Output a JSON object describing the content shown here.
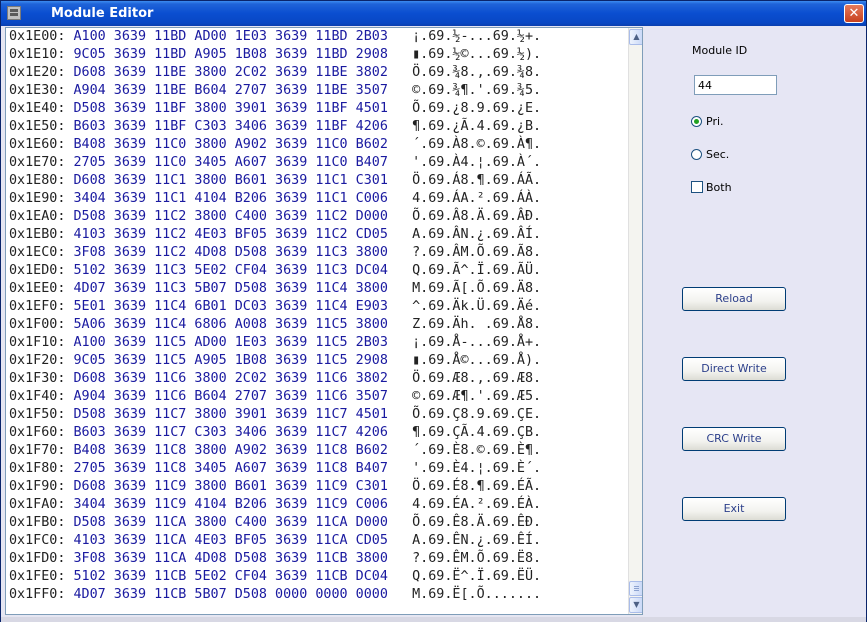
{
  "window": {
    "title": "Module Editor",
    "close_glyph": "✕"
  },
  "icons": {
    "app": "app-window-icon",
    "close": "close-icon",
    "scroll_up": "arrow-up-icon",
    "scroll_down": "arrow-down-icon"
  },
  "colors": {
    "title_bar": "#0a4ed0",
    "hex_values": "#1a1aa0",
    "radio_dot": "#21a121",
    "button_text": "#2b3e8a",
    "side_panel": "#e6e6f4"
  },
  "hex_rows": [
    {
      "addr": "0x1E00:",
      "hex": "A100 3639 11BD AD00 1E03 3639 11BD 2B03",
      "ascii": "¡.69.½-...69.½+."
    },
    {
      "addr": "0x1E10:",
      "hex": "9C05 3639 11BD A905 1B08 3639 11BD 2908",
      "ascii": "▮.69.½©...69.½)."
    },
    {
      "addr": "0x1E20:",
      "hex": "D608 3639 11BE 3800 2C02 3639 11BE 3802",
      "ascii": "Ö.69.¾8.,.69.¾8."
    },
    {
      "addr": "0x1E30:",
      "hex": "A904 3639 11BE B604 2707 3639 11BE 3507",
      "ascii": "©.69.¾¶.'.69.¾5."
    },
    {
      "addr": "0x1E40:",
      "hex": "D508 3639 11BF 3800 3901 3639 11BF 4501",
      "ascii": "Õ.69.¿8.9.69.¿E."
    },
    {
      "addr": "0x1E50:",
      "hex": "B603 3639 11BF C303 3406 3639 11BF 4206",
      "ascii": "¶.69.¿Ã.4.69.¿B."
    },
    {
      "addr": "0x1E60:",
      "hex": "B408 3639 11C0 3800 A902 3639 11C0 B602",
      "ascii": "´.69.À8.©.69.À¶."
    },
    {
      "addr": "0x1E70:",
      "hex": "2705 3639 11C0 3405 A607 3639 11C0 B407",
      "ascii": "'.69.À4.¦.69.À´."
    },
    {
      "addr": "0x1E80:",
      "hex": "D608 3639 11C1 3800 B601 3639 11C1 C301",
      "ascii": "Ö.69.Á8.¶.69.ÁÃ."
    },
    {
      "addr": "0x1E90:",
      "hex": "3404 3639 11C1 4104 B206 3639 11C1 C006",
      "ascii": "4.69.ÁA.².69.ÁÀ."
    },
    {
      "addr": "0x1EA0:",
      "hex": "D508 3639 11C2 3800 C400 3639 11C2 D000",
      "ascii": "Õ.69.Â8.Ä.69.ÂÐ."
    },
    {
      "addr": "0x1EB0:",
      "hex": "4103 3639 11C2 4E03 BF05 3639 11C2 CD05",
      "ascii": "A.69.ÂN.¿.69.ÂÍ."
    },
    {
      "addr": "0x1EC0:",
      "hex": "3F08 3639 11C2 4D08 D508 3639 11C3 3800",
      "ascii": "?.69.ÂM.Õ.69.Ã8."
    },
    {
      "addr": "0x1ED0:",
      "hex": "5102 3639 11C3 5E02 CF04 3639 11C3 DC04",
      "ascii": "Q.69.Ã^.Ï.69.ÃÜ."
    },
    {
      "addr": "0x1EE0:",
      "hex": "4D07 3639 11C3 5B07 D508 3639 11C4 3800",
      "ascii": "M.69.Ã[.Õ.69.Ä8."
    },
    {
      "addr": "0x1EF0:",
      "hex": "5E01 3639 11C4 6B01 DC03 3639 11C4 E903",
      "ascii": "^.69.Äk.Ü.69.Äé."
    },
    {
      "addr": "0x1F00:",
      "hex": "5A06 3639 11C4 6806 A008 3639 11C5 3800",
      "ascii": "Z.69.Äh. .69.Å8."
    },
    {
      "addr": "0x1F10:",
      "hex": "A100 3639 11C5 AD00 1E03 3639 11C5 2B03",
      "ascii": "¡.69.Å-...69.Å+."
    },
    {
      "addr": "0x1F20:",
      "hex": "9C05 3639 11C5 A905 1B08 3639 11C5 2908",
      "ascii": "▮.69.Å©...69.Å)."
    },
    {
      "addr": "0x1F30:",
      "hex": "D608 3639 11C6 3800 2C02 3639 11C6 3802",
      "ascii": "Ö.69.Æ8.,.69.Æ8."
    },
    {
      "addr": "0x1F40:",
      "hex": "A904 3639 11C6 B604 2707 3639 11C6 3507",
      "ascii": "©.69.Æ¶.'.69.Æ5."
    },
    {
      "addr": "0x1F50:",
      "hex": "D508 3639 11C7 3800 3901 3639 11C7 4501",
      "ascii": "Õ.69.Ç8.9.69.ÇE."
    },
    {
      "addr": "0x1F60:",
      "hex": "B603 3639 11C7 C303 3406 3639 11C7 4206",
      "ascii": "¶.69.ÇÃ.4.69.ÇB."
    },
    {
      "addr": "0x1F70:",
      "hex": "B408 3639 11C8 3800 A902 3639 11C8 B602",
      "ascii": "´.69.È8.©.69.È¶."
    },
    {
      "addr": "0x1F80:",
      "hex": "2705 3639 11C8 3405 A607 3639 11C8 B407",
      "ascii": "'.69.È4.¦.69.È´."
    },
    {
      "addr": "0x1F90:",
      "hex": "D608 3639 11C9 3800 B601 3639 11C9 C301",
      "ascii": "Ö.69.É8.¶.69.ÉÃ."
    },
    {
      "addr": "0x1FA0:",
      "hex": "3404 3639 11C9 4104 B206 3639 11C9 C006",
      "ascii": "4.69.ÉA.².69.ÉÀ."
    },
    {
      "addr": "0x1FB0:",
      "hex": "D508 3639 11CA 3800 C400 3639 11CA D000",
      "ascii": "Õ.69.Ê8.Ä.69.ÊÐ."
    },
    {
      "addr": "0x1FC0:",
      "hex": "4103 3639 11CA 4E03 BF05 3639 11CA CD05",
      "ascii": "A.69.ÊN.¿.69.ÊÍ."
    },
    {
      "addr": "0x1FD0:",
      "hex": "3F08 3639 11CA 4D08 D508 3639 11CB 3800",
      "ascii": "?.69.ÊM.Õ.69.Ë8."
    },
    {
      "addr": "0x1FE0:",
      "hex": "5102 3639 11CB 5E02 CF04 3639 11CB DC04",
      "ascii": "Q.69.Ë^.Ï.69.ËÜ."
    },
    {
      "addr": "0x1FF0:",
      "hex": "4D07 3639 11CB 5B07 D508 0000 0000 0000",
      "ascii": "M.69.Ë[.Õ......."
    }
  ],
  "side": {
    "module_id_label": "Module ID",
    "module_id_value": "44",
    "pri_label": "Pri.",
    "pri_checked": true,
    "sec_label": "Sec.",
    "sec_checked": false,
    "both_label": "Both",
    "both_checked": false
  },
  "buttons": {
    "reload": "Reload",
    "direct_write": "Direct Write",
    "crc_write": "CRC Write",
    "exit": "Exit"
  }
}
